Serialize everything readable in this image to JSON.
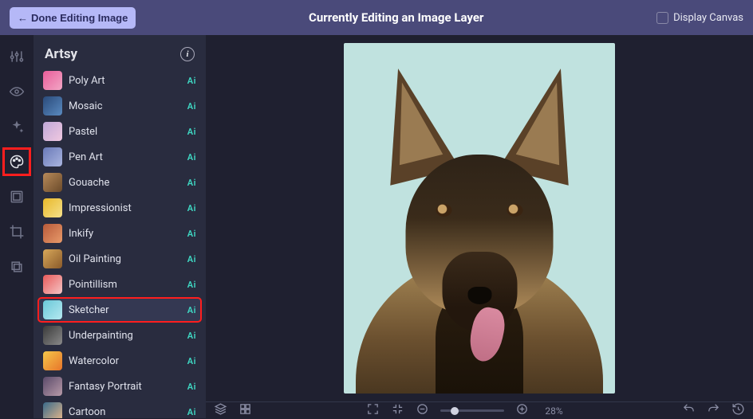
{
  "header": {
    "done_label": "Done Editing Image",
    "title": "Currently Editing an Image Layer",
    "display_canvas_label": "Display Canvas"
  },
  "panel": {
    "title": "Artsy"
  },
  "effects": [
    {
      "name": "Poly Art",
      "ai": "Ai",
      "thumb_bg": "linear-gradient(135deg,#e85d9a,#f2a6c5)"
    },
    {
      "name": "Mosaic",
      "ai": "Ai",
      "thumb_bg": "linear-gradient(135deg,#2a4a7a,#5a8ac0)"
    },
    {
      "name": "Pastel",
      "ai": "Ai",
      "thumb_bg": "linear-gradient(135deg,#bfa8d8,#f0c8e0)"
    },
    {
      "name": "Pen Art",
      "ai": "Ai",
      "thumb_bg": "linear-gradient(135deg,#6a7ab8,#aab5e0)"
    },
    {
      "name": "Gouache",
      "ai": "Ai",
      "thumb_bg": "linear-gradient(135deg,#b88a5a,#6a4a2a)"
    },
    {
      "name": "Impressionist",
      "ai": "Ai",
      "thumb_bg": "linear-gradient(135deg,#e8b82a,#f5e08a)"
    },
    {
      "name": "Inkify",
      "ai": "Ai",
      "thumb_bg": "linear-gradient(135deg,#b85a3a,#e89a6a)"
    },
    {
      "name": "Oil Painting",
      "ai": "Ai",
      "thumb_bg": "linear-gradient(135deg,#d8a85a,#8a5a2a)"
    },
    {
      "name": "Pointillism",
      "ai": "Ai",
      "thumb_bg": "linear-gradient(135deg,#e85a5a,#f5c5c5)"
    },
    {
      "name": "Sketcher",
      "ai": "Ai",
      "thumb_bg": "linear-gradient(135deg,#6ac8d8,#b5e8f0)",
      "highlighted": true
    },
    {
      "name": "Underpainting",
      "ai": "Ai",
      "thumb_bg": "linear-gradient(135deg,#3a3a3a,#8a8a8a)"
    },
    {
      "name": "Watercolor",
      "ai": "Ai",
      "thumb_bg": "linear-gradient(135deg,#f5c84a,#e8752a)"
    },
    {
      "name": "Fantasy Portrait",
      "ai": "Ai",
      "thumb_bg": "linear-gradient(135deg,#5a4a6a,#b89aa8)"
    },
    {
      "name": "Cartoon",
      "ai": "Ai",
      "thumb_bg": "linear-gradient(135deg,#3a6a8a,#e8b88a)"
    }
  ],
  "tools": [
    {
      "name": "adjust-icon"
    },
    {
      "name": "eye-icon"
    },
    {
      "name": "sparkle-icon"
    },
    {
      "name": "palette-icon",
      "highlighted": true
    },
    {
      "name": "frame-icon"
    },
    {
      "name": "crop-icon"
    },
    {
      "name": "layers-icon"
    }
  ],
  "bottom": {
    "zoom_value": "28%"
  }
}
